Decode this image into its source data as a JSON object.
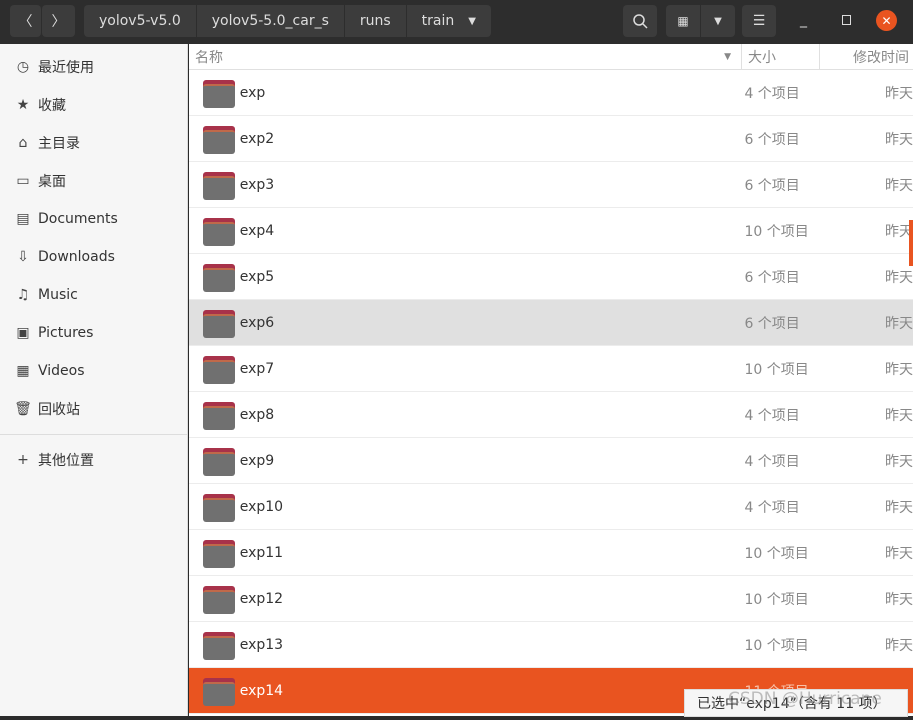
{
  "toolbar": {
    "back": "〈",
    "forward": "〉",
    "breadcrumbs": [
      "yolov5-v5.0",
      "yolov5-5.0_car_s",
      "runs",
      "train"
    ],
    "search_icon": "search-icon",
    "view_icon": "grid-icon",
    "menu_icon": "hamburger-icon"
  },
  "sidebar": {
    "items": [
      {
        "label": "最近使用",
        "icon": "◷"
      },
      {
        "label": "收藏",
        "icon": "★"
      },
      {
        "label": "主目录",
        "icon": "⌂"
      },
      {
        "label": "桌面",
        "icon": "▭"
      },
      {
        "label": "Documents",
        "icon": "▤"
      },
      {
        "label": "Downloads",
        "icon": "⇩"
      },
      {
        "label": "Music",
        "icon": "♫"
      },
      {
        "label": "Pictures",
        "icon": "▣"
      },
      {
        "label": "Videos",
        "icon": "▦"
      },
      {
        "label": "回收站",
        "icon": "🗑"
      }
    ],
    "other": {
      "label": "其他位置",
      "icon": "+"
    }
  },
  "columns": {
    "name": "名称",
    "size": "大小",
    "modified": "修改时间"
  },
  "rows": [
    {
      "name": "exp",
      "size": "4 个项目",
      "date": "昨天"
    },
    {
      "name": "exp2",
      "size": "6 个项目",
      "date": "昨天"
    },
    {
      "name": "exp3",
      "size": "6 个项目",
      "date": "昨天"
    },
    {
      "name": "exp4",
      "size": "10 个项目",
      "date": "昨天"
    },
    {
      "name": "exp5",
      "size": "6 个项目",
      "date": "昨天"
    },
    {
      "name": "exp6",
      "size": "6 个项目",
      "date": "昨天"
    },
    {
      "name": "exp7",
      "size": "10 个项目",
      "date": "昨天"
    },
    {
      "name": "exp8",
      "size": "4 个项目",
      "date": "昨天"
    },
    {
      "name": "exp9",
      "size": "4 个项目",
      "date": "昨天"
    },
    {
      "name": "exp10",
      "size": "4 个项目",
      "date": "昨天"
    },
    {
      "name": "exp11",
      "size": "10 个项目",
      "date": "昨天"
    },
    {
      "name": "exp12",
      "size": "10 个项目",
      "date": "昨天"
    },
    {
      "name": "exp13",
      "size": "10 个项目",
      "date": "昨天"
    },
    {
      "name": "exp14",
      "size": "11 个项目",
      "date": ""
    }
  ],
  "status": "已选中“exp14”（含有 11 项）",
  "watermark": "CSDN @Hurricane",
  "accent": "#e95420"
}
